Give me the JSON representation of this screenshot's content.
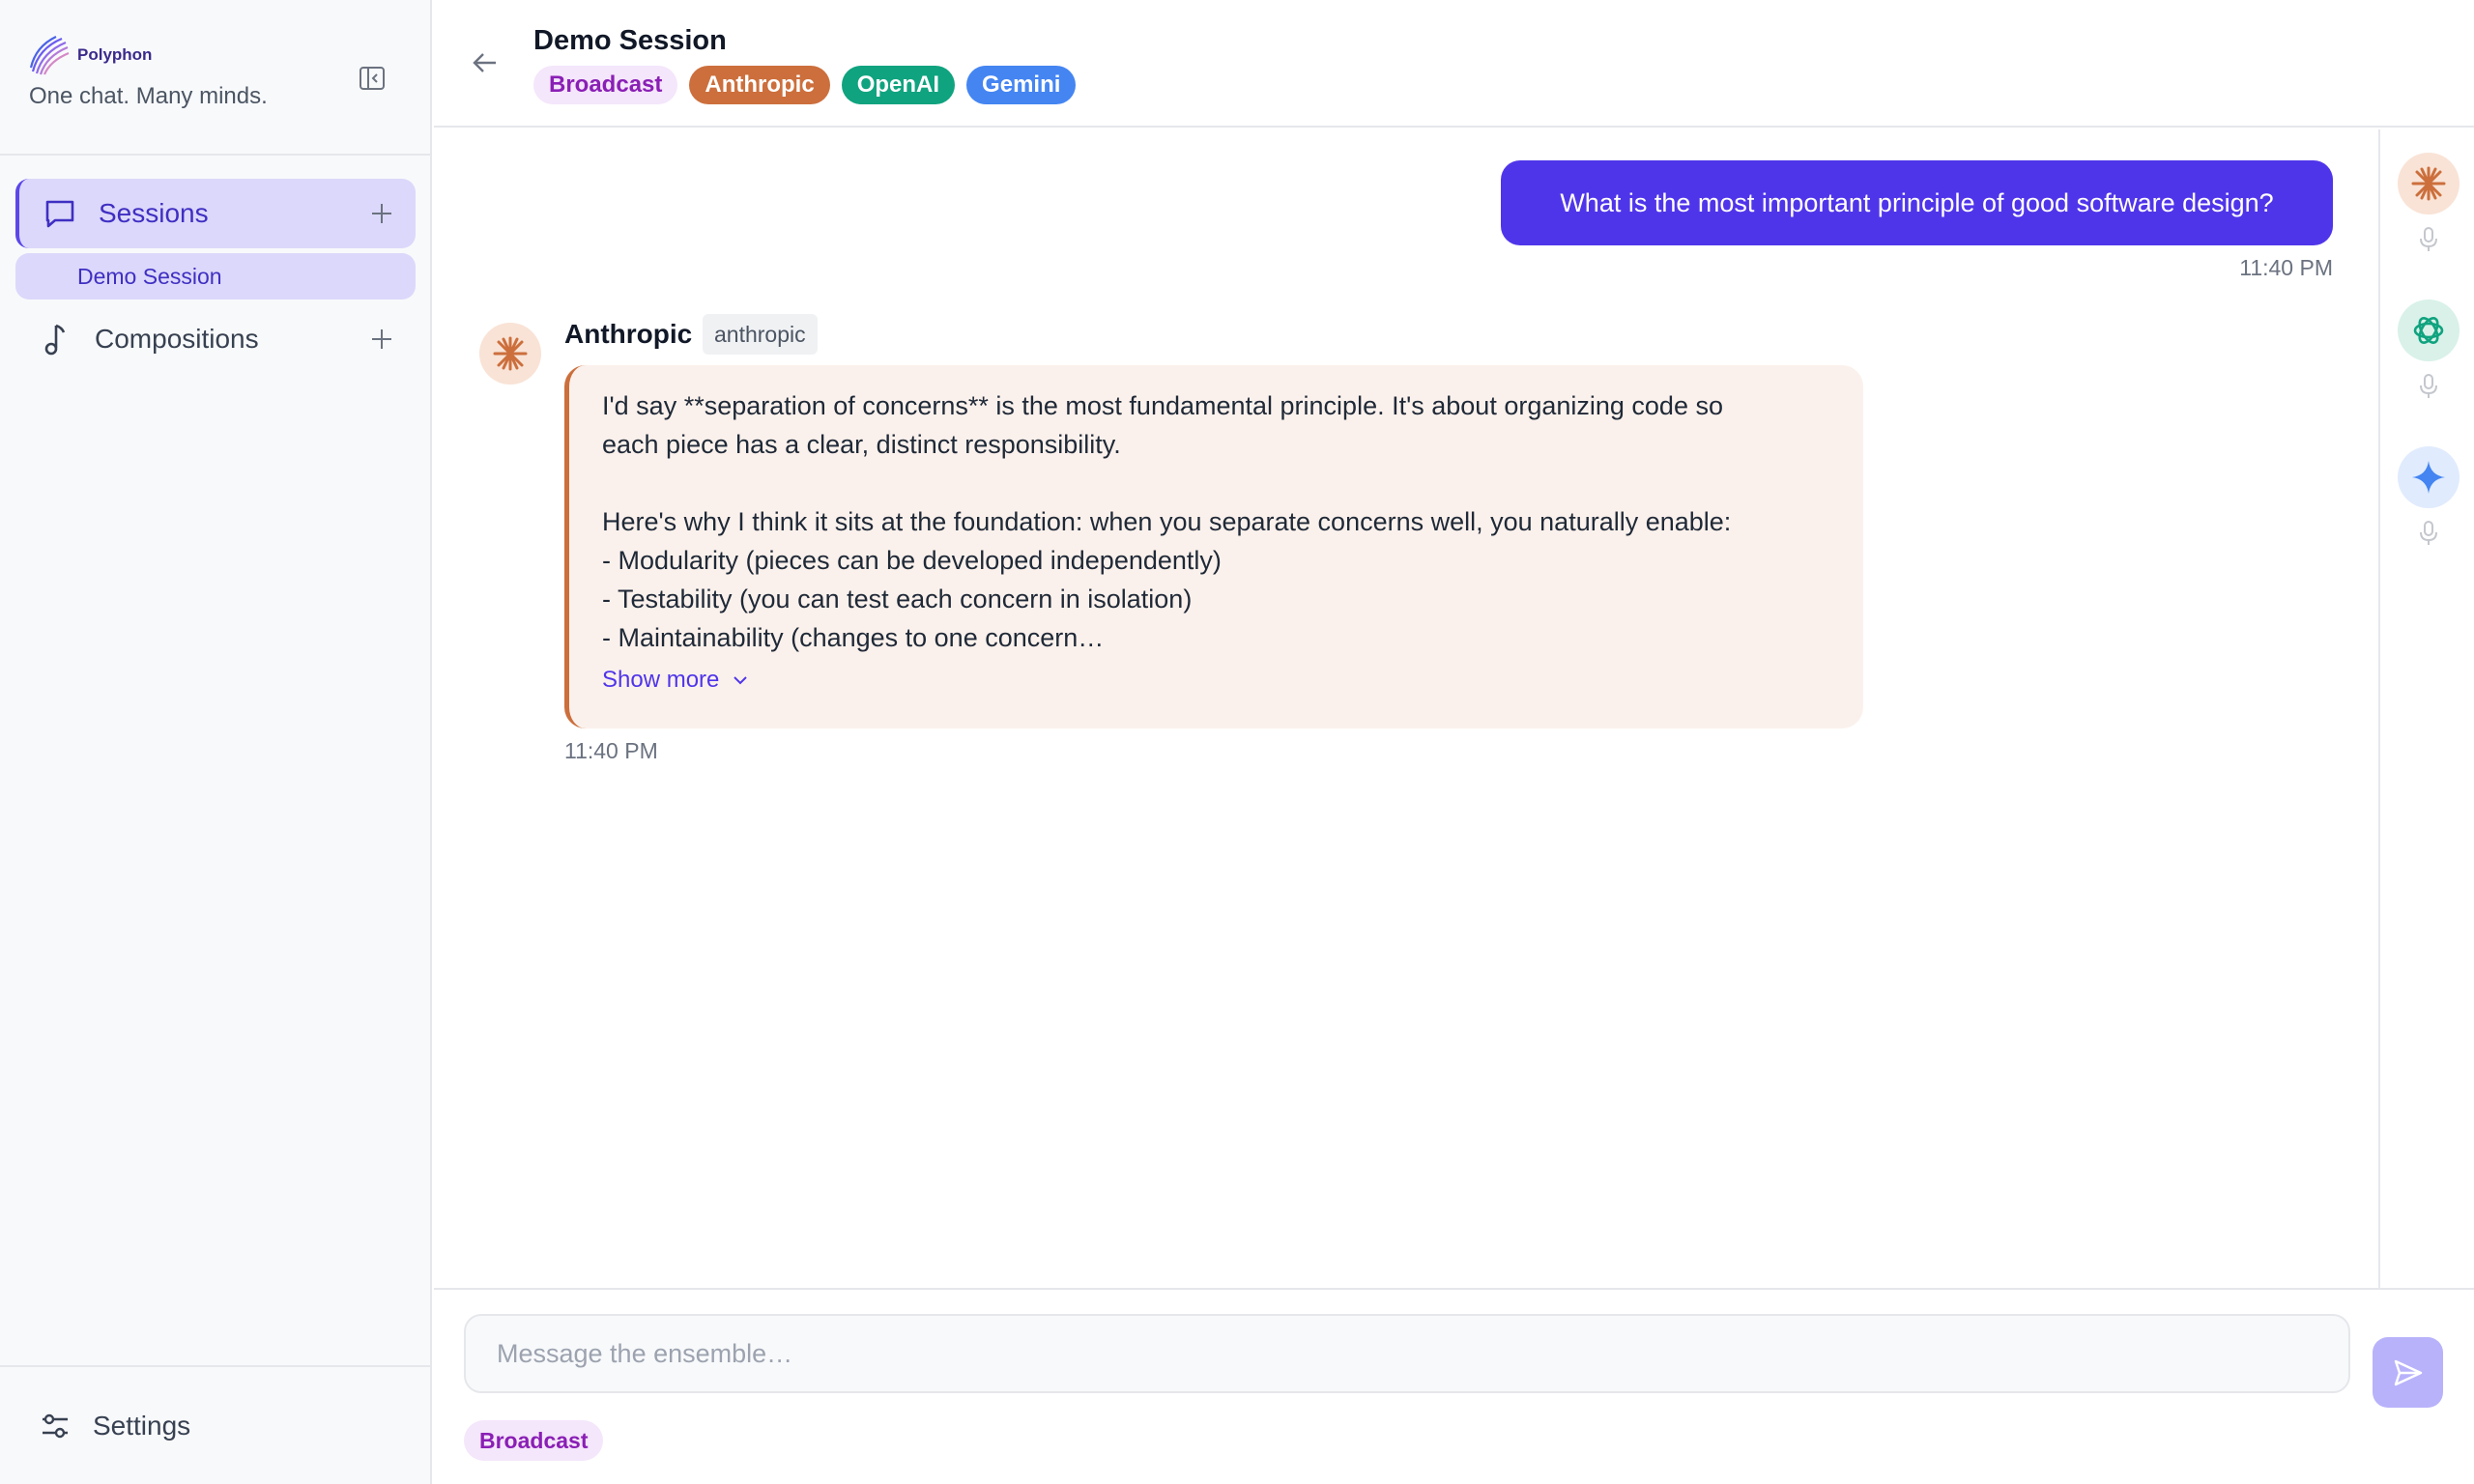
{
  "app": {
    "name": "Polyphon",
    "tagline": "One chat. Many minds."
  },
  "sidebar": {
    "sessions_label": "Sessions",
    "active_session": "Demo Session",
    "compositions_label": "Compositions",
    "settings_label": "Settings"
  },
  "header": {
    "title": "Demo Session",
    "chips": [
      "Broadcast",
      "Anthropic",
      "OpenAI",
      "Gemini"
    ]
  },
  "messages": {
    "user": {
      "text": "What is the most important principle of good software design?",
      "time": "11:40 PM"
    },
    "assistant": {
      "name": "Anthropic",
      "provider_tag": "anthropic",
      "lines": [
        "I'd say **separation of concerns** is the most fundamental principle. It's about organizing code so",
        "each piece has a clear, distinct responsibility.",
        "",
        "Here's why I think it sits at the foundation: when you separate concerns well, you naturally enable:",
        "- Modularity (pieces can be developed independently)",
        "- Testability (you can test each concern in isolation)",
        "- Maintainability (changes to one concern…"
      ],
      "show_more": "Show more",
      "time": "11:40 PM"
    }
  },
  "composer": {
    "placeholder": "Message the ensemble…",
    "mode_chip": "Broadcast"
  },
  "colors": {
    "accent": "#4f35ea",
    "anthropic": "#cc6f3c",
    "openai": "#10a37f",
    "gemini": "#4485f2",
    "broadcast": "#8a1fb5"
  },
  "icons": [
    "polyphon-logo-icon",
    "sidebar-collapse-icon",
    "chat-bubble-icon",
    "plus-icon",
    "music-note-icon",
    "sliders-icon",
    "back-arrow-icon",
    "anthropic-icon",
    "openai-icon",
    "gemini-icon",
    "microphone-icon",
    "chevron-down-icon",
    "send-icon"
  ]
}
